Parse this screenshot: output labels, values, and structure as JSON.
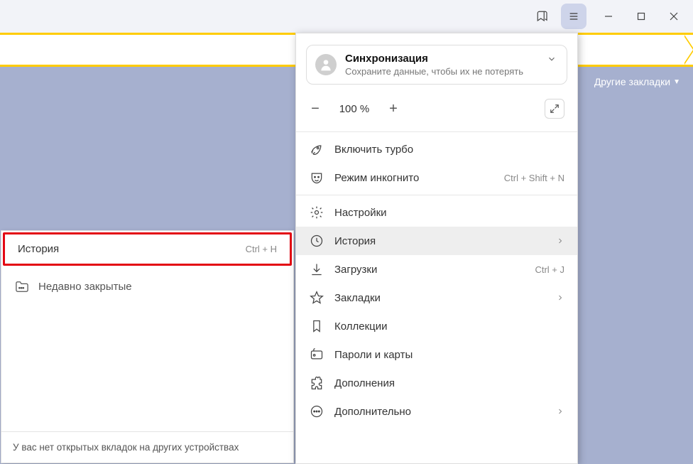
{
  "titlebar": {},
  "otherBookmarks": "Другие закладки",
  "historyPanel": {
    "title": "История",
    "shortcut": "Ctrl + H",
    "recentlyClosed": "Недавно закрытые",
    "footer": "У вас нет открытых вкладок на других устройствах"
  },
  "menu": {
    "sync": {
      "title": "Синхронизация",
      "subtitle": "Сохраните данные, чтобы их не потерять"
    },
    "zoom": {
      "value": "100 %"
    },
    "items": {
      "turbo": {
        "label": "Включить турбо"
      },
      "incognito": {
        "label": "Режим инкогнито",
        "shortcut": "Ctrl + Shift + N"
      },
      "settings": {
        "label": "Настройки"
      },
      "history": {
        "label": "История"
      },
      "downloads": {
        "label": "Загрузки",
        "shortcut": "Ctrl + J"
      },
      "bookmarks": {
        "label": "Закладки"
      },
      "collections": {
        "label": "Коллекции"
      },
      "passwords": {
        "label": "Пароли и карты"
      },
      "addons": {
        "label": "Дополнения"
      },
      "more": {
        "label": "Дополнительно"
      }
    }
  }
}
